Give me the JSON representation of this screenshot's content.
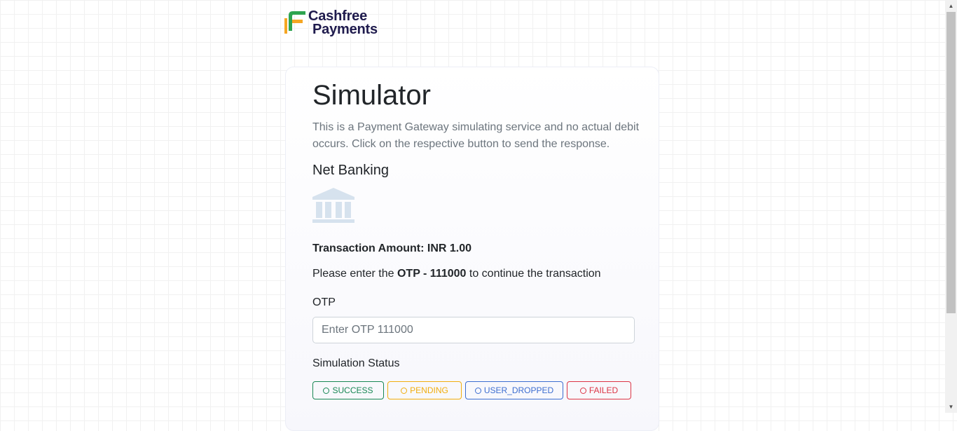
{
  "brand": {
    "line1": "Cashfree",
    "line2": "Payments",
    "logo_icon": "cashfree-logo-icon",
    "colors": {
      "green": "#2ea44f",
      "orange": "#f5a623",
      "navy": "#1f1b4d"
    }
  },
  "simulator": {
    "title": "Simulator",
    "description": "This is a Payment Gateway simulating service and no actual debit occurs. Click on the respective button to send the response.",
    "method_title": "Net Banking",
    "method_icon": "bank-icon",
    "amount_label": "Transaction Amount:",
    "amount_value": "INR 1.00",
    "otp_note_prefix": "Please enter the",
    "otp_note_code": "OTP - 111000",
    "otp_note_suffix": "to continue the transaction",
    "otp_label": "OTP",
    "otp_placeholder": "Enter OTP 111000",
    "otp_value": "",
    "status_label": "Simulation Status",
    "statuses": [
      {
        "label": "SUCCESS",
        "color": "#198754"
      },
      {
        "label": "PENDING",
        "color": "#f0ad0e"
      },
      {
        "label": "USER_DROPPED",
        "color": "#3d6ed0"
      },
      {
        "label": "FAILED",
        "color": "#dc3545"
      }
    ]
  },
  "scrollbar": {
    "up_icon": "scroll-up-arrow-icon",
    "down_icon": "scroll-down-arrow-icon"
  }
}
